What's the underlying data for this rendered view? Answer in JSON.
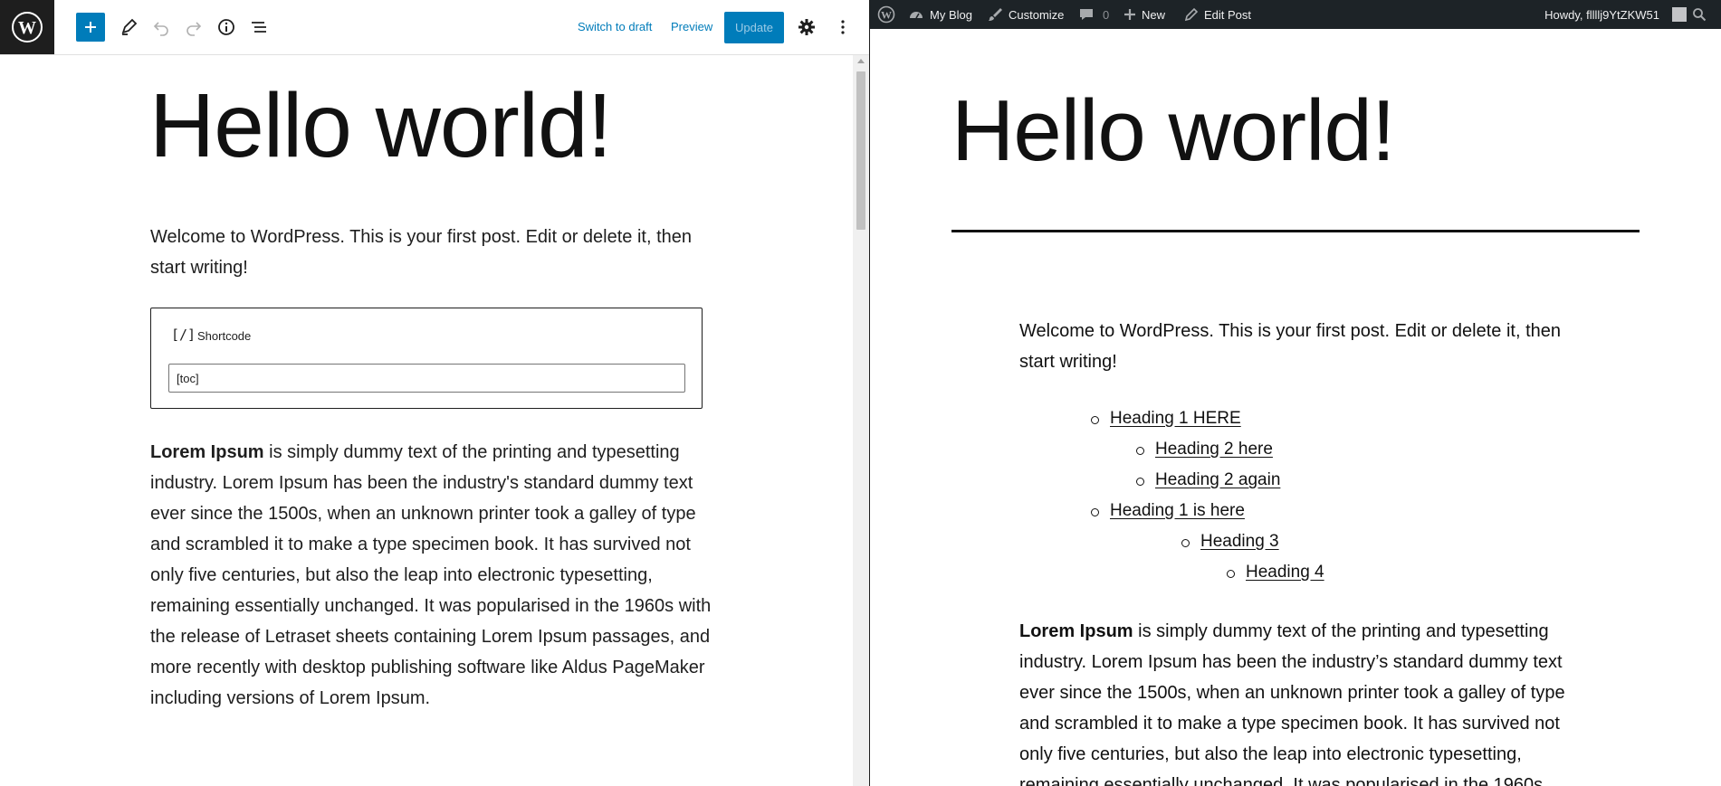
{
  "editor": {
    "toolbar": {
      "add_block_label": "Add block",
      "switch_to_draft": "Switch to draft",
      "preview": "Preview",
      "update": "Update"
    },
    "post": {
      "title": "Hello world!",
      "welcome": "Welcome to WordPress. This is your first post. Edit or delete it, then start writing!",
      "shortcode_block": {
        "icon": "[/]",
        "label": "Shortcode",
        "value": "[toc]"
      },
      "lorem_bold": "Lorem Ipsum",
      "lorem_rest": " is simply dummy text of the printing and typesetting industry. Lorem Ipsum has been the industry's standard dummy text ever since the 1500s, when an unknown printer took a galley of type and scrambled it to make a type specimen book. It has survived not only five centuries, but also the leap into electronic typesetting, remaining essentially unchanged. It was popularised in the 1960s with the release of Letraset sheets containing Lorem Ipsum passages, and more recently with desktop publishing software like Aldus PageMaker including versions of Lorem Ipsum."
    }
  },
  "adminbar": {
    "my_blog": "My Blog",
    "customize": "Customize",
    "comments_count": "0",
    "new": "New",
    "edit_post": "Edit Post",
    "howdy": "Howdy, fllllj9YtZKW51"
  },
  "frontend": {
    "title": "Hello world!",
    "welcome": "Welcome to WordPress. This is your first post. Edit or delete it, then start writing!",
    "toc": [
      {
        "text": "Heading 1 HERE"
      },
      {
        "text": "Heading 2 here"
      },
      {
        "text": "Heading 2 again"
      },
      {
        "text": "Heading 1 is here"
      },
      {
        "text": "Heading 3"
      },
      {
        "text": "Heading 4"
      }
    ],
    "lorem_bold": "Lorem Ipsum",
    "lorem_rest": " is simply dummy text of the printing and typesetting industry. Lorem Ipsum has been the industry’s standard dummy text ever since the 1500s, when an unknown printer took a galley of type and scrambled it to make a type specimen book. It has survived not only five centuries, but also the leap into electronic typesetting, remaining essentially unchanged. It was popularised in the 1960s"
  },
  "colors": {
    "accent": "#007cba",
    "adminbar_bg": "#1d2327",
    "logo_tile": "#1e1e1e"
  },
  "icons": [
    "wordpress-icon",
    "plus-icon",
    "pen-icon",
    "undo-icon",
    "redo-icon",
    "info-icon",
    "list-view-icon",
    "gear-icon",
    "more-vertical-icon",
    "dashboard-icon",
    "brush-icon",
    "comment-icon",
    "pencil-icon",
    "search-icon"
  ]
}
